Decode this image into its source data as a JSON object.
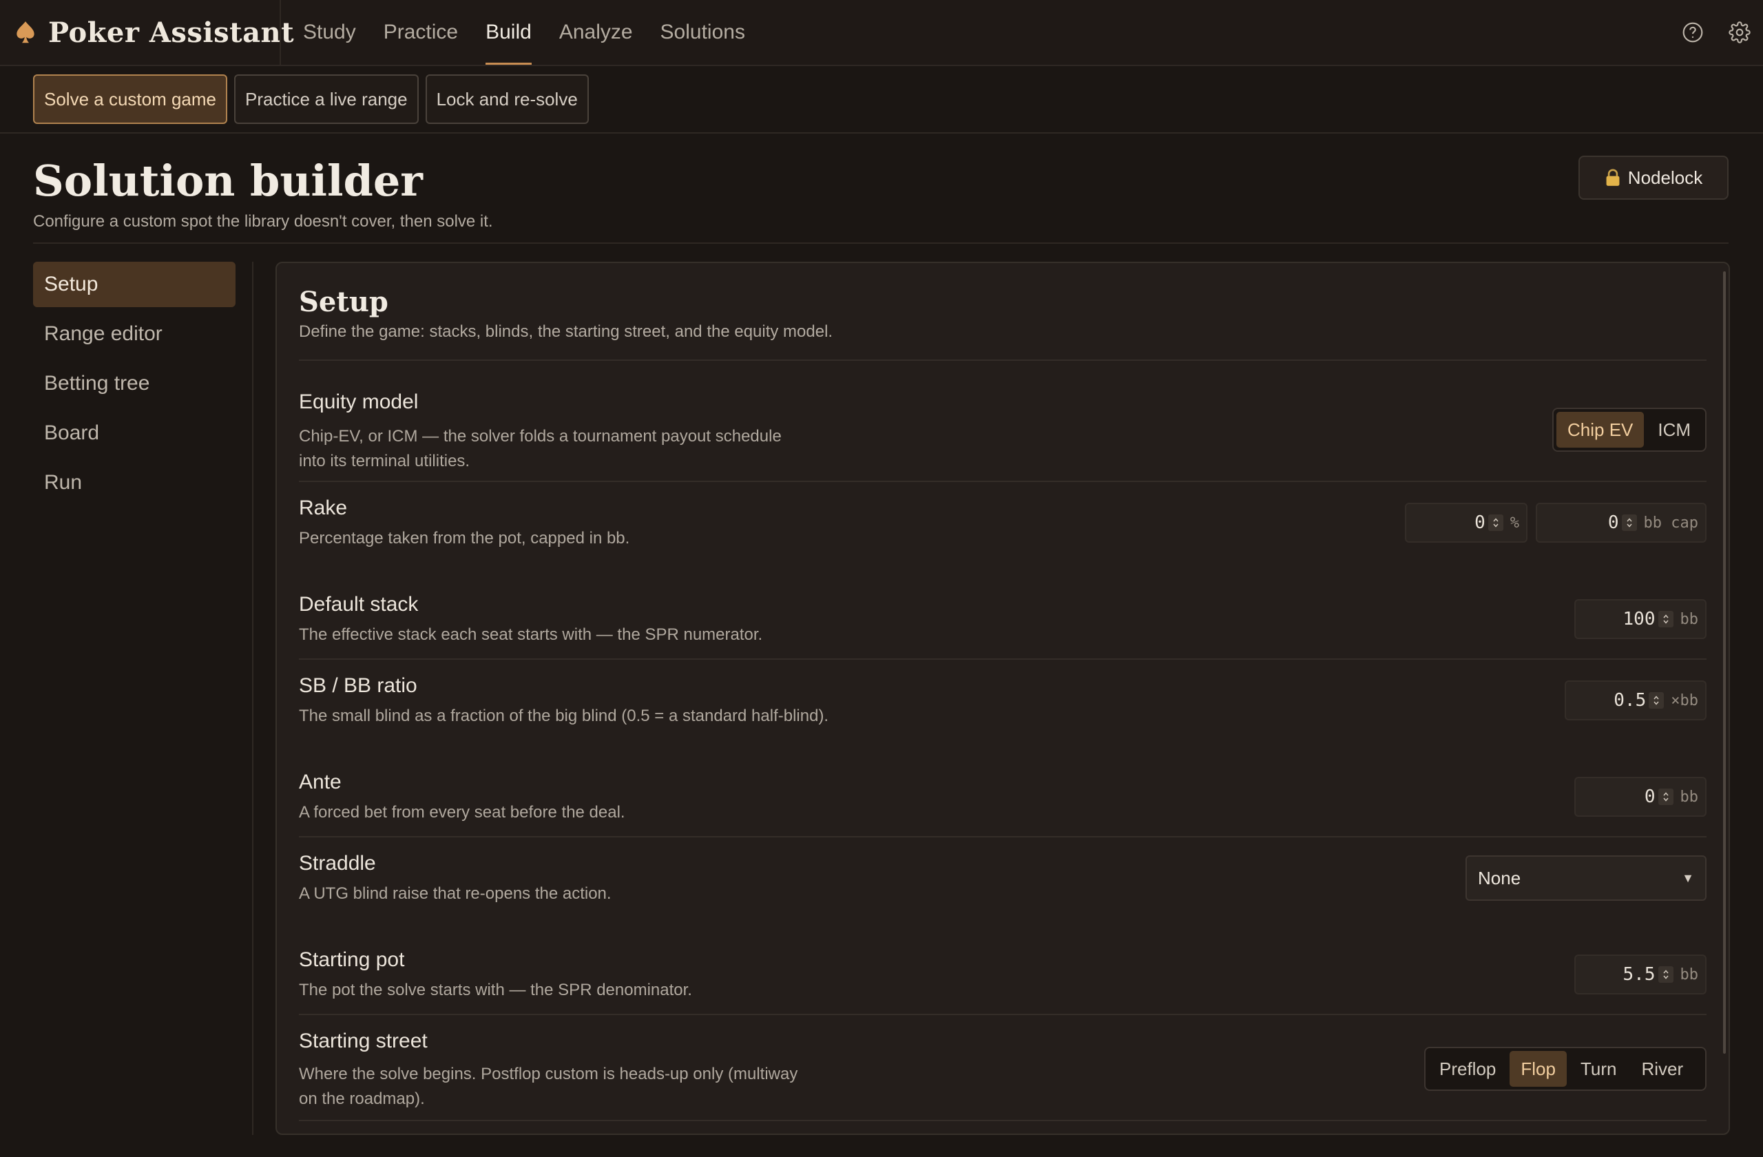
{
  "brand": {
    "name": "Poker Assistant",
    "icon": "spade-icon"
  },
  "nav": {
    "links": [
      "Study",
      "Practice",
      "Build",
      "Analyze",
      "Solutions"
    ],
    "active": "Build",
    "icons": [
      "help-icon",
      "settings-icon"
    ]
  },
  "subnav": {
    "tabs": [
      "Solve a custom game",
      "Practice a live range",
      "Lock and re-solve"
    ],
    "active": "Solve a custom game"
  },
  "header": {
    "title": "Solution builder",
    "subtitle": "Configure a custom spot the library doesn't cover, then solve it.",
    "nodelock_label": "Nodelock",
    "nodelock_icon": "lock-icon"
  },
  "sidebar": {
    "items": [
      "Setup",
      "Range editor",
      "Betting tree",
      "Board",
      "Run"
    ],
    "active": "Setup"
  },
  "setup": {
    "title": "Setup",
    "subtitle": "Define the game: stacks, blinds, the starting street, and the equity model.",
    "equity": {
      "label": "Equity model",
      "desc1": "Chip-EV, or ICM — the solver folds a tournament payout schedule",
      "desc2": "into its terminal utilities.",
      "options": [
        "Chip EV",
        "ICM"
      ],
      "selected": "Chip EV"
    },
    "rake": {
      "label": "Rake",
      "desc": "Percentage taken from the pot, capped in bb.",
      "percent_value": "0",
      "percent_unit": "%",
      "cap_value": "0",
      "cap_unit": "bb cap"
    },
    "stack": {
      "label": "Default stack",
      "desc": "The effective stack each seat starts with — the SPR numerator.",
      "value": "100",
      "unit": "bb"
    },
    "sbbb": {
      "label": "SB / BB ratio",
      "desc": "The small blind as a fraction of the big blind (0.5 = a standard half-blind).",
      "value": "0.5",
      "unit": "×bb"
    },
    "ante": {
      "label": "Ante",
      "desc": "A forced bet from every seat before the deal.",
      "value": "0",
      "unit": "bb"
    },
    "straddle": {
      "label": "Straddle",
      "desc": "A UTG blind raise that re-opens the action.",
      "value": "None"
    },
    "pot": {
      "label": "Starting pot",
      "desc": "The pot the solve starts with — the SPR denominator.",
      "value": "5.5",
      "unit": "bb"
    },
    "street": {
      "label": "Starting street",
      "desc1": "Where the solve begins. Postflop custom is heads-up only (multiway",
      "desc2": "on the roadmap).",
      "options": [
        "Preflop",
        "Flop",
        "Turn",
        "River"
      ],
      "selected": "Flop"
    }
  },
  "colors": {
    "accent": "#c88d52",
    "active_bg": "#4a3522",
    "active_text": "#f2ce9f"
  }
}
